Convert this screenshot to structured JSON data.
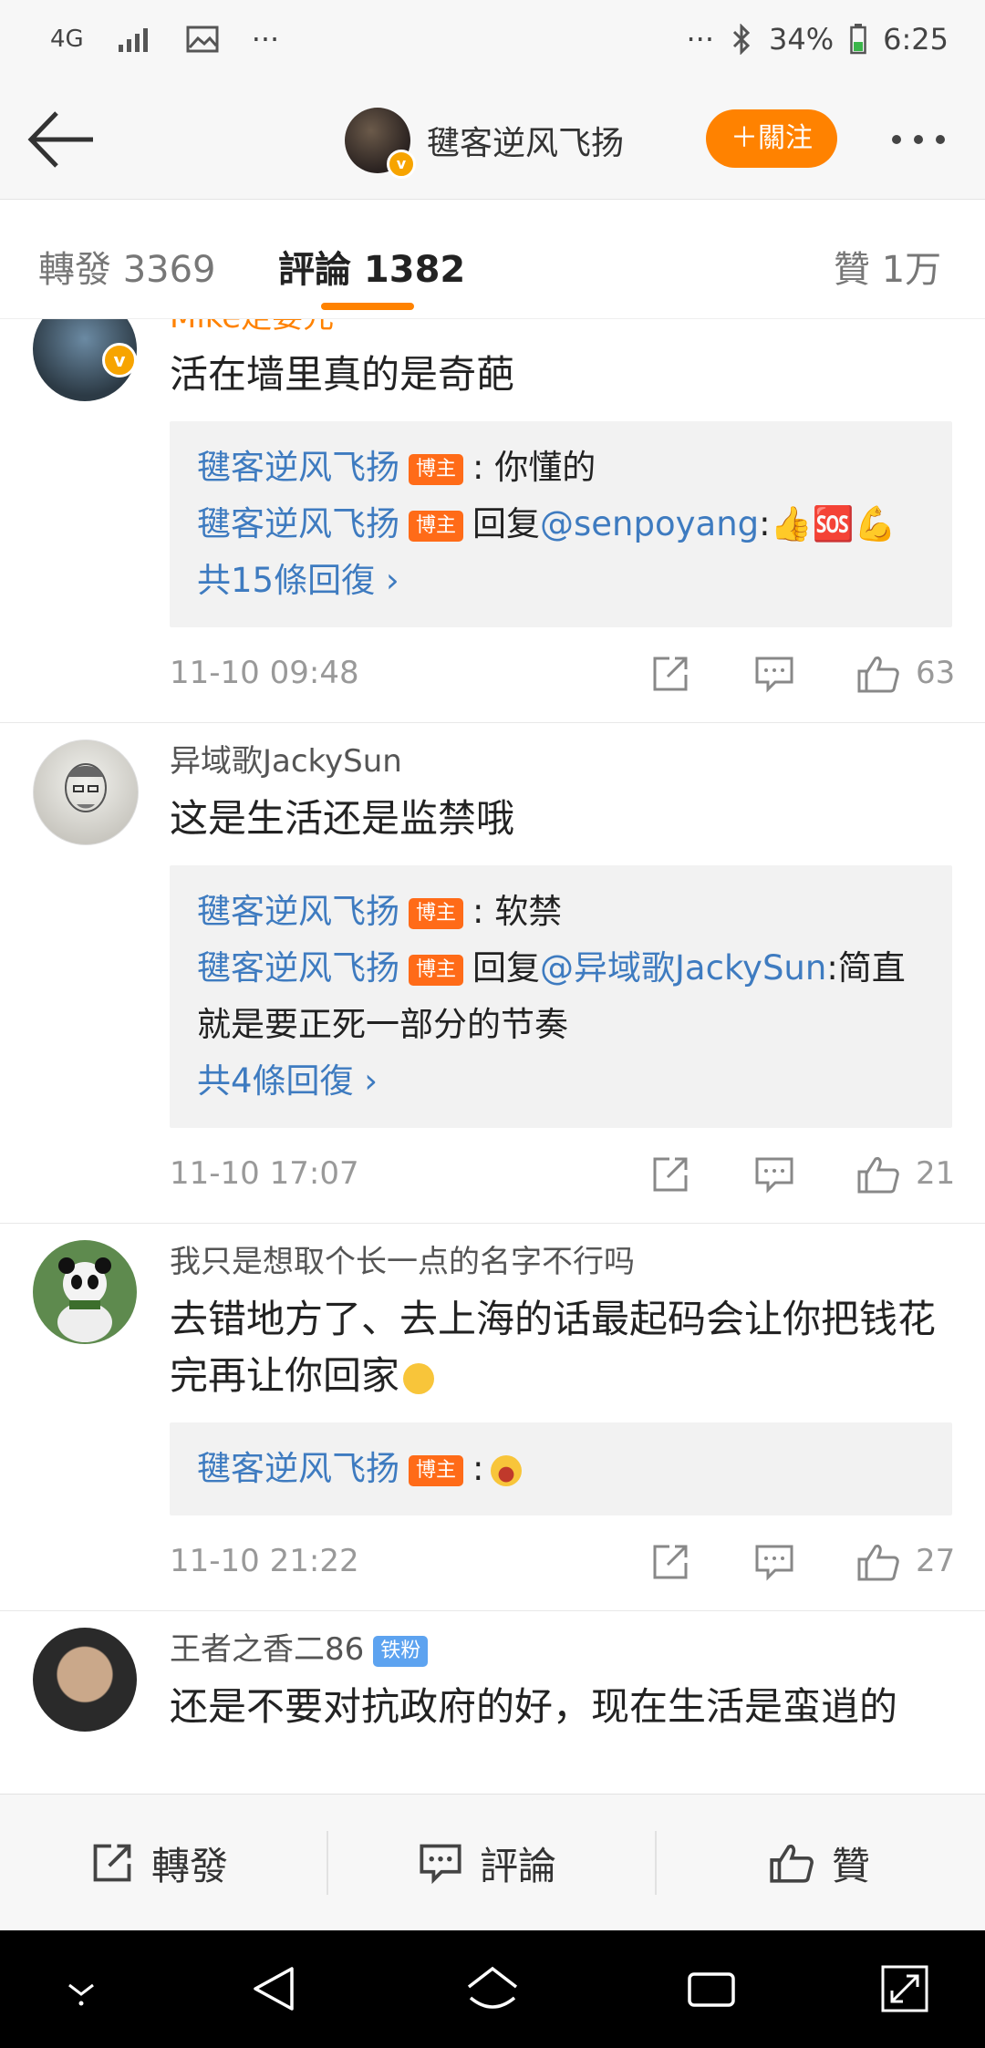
{
  "status_bar": {
    "network": "4G",
    "battery": "34%",
    "time": "6:25",
    "dots": "···"
  },
  "header": {
    "user_name": "毽客逆风飞扬",
    "follow_label": "＋關注"
  },
  "tabs": {
    "repost": "轉發 3369",
    "comments": "評論 1382",
    "likes": "贊 1万"
  },
  "comments": [
    {
      "name": "Mike走要元",
      "text": "活在墙里真的是奇葩",
      "replies": [
        {
          "name": "毽客逆风飞扬",
          "tag": "博主",
          "prefix": "",
          "mention": "",
          "text": ": 你懂的"
        },
        {
          "name": "毽客逆风飞扬",
          "tag": "博主",
          "prefix": "回复",
          "mention": "@senpoyang",
          "text": ":👍🆘💪"
        }
      ],
      "more": "共15條回復 ›",
      "time": "11-10 09:48",
      "likes": "63"
    },
    {
      "name": "异域歌JackySun",
      "text": "这是生活还是监禁哦",
      "replies": [
        {
          "name": "毽客逆风飞扬",
          "tag": "博主",
          "prefix": "",
          "mention": "",
          "text": ": 软禁"
        },
        {
          "name": "毽客逆风飞扬",
          "tag": "博主",
          "prefix": "回复",
          "mention": "@异域歌JackySun",
          "text": ":简直就是要正死一部分的节奏"
        }
      ],
      "more": "共4條回復 ›",
      "time": "11-10 17:07",
      "likes": "21"
    },
    {
      "name": "我只是想取个长一点的名字不行吗",
      "text": "去错地方了、去上海的话最起码会让你把钱花完再让你回家",
      "replies": [
        {
          "name": "毽客逆风飞扬",
          "tag": "博主",
          "prefix": "",
          "mention": "",
          "text": ":"
        }
      ],
      "more": "",
      "time": "11-10 21:22",
      "likes": "27"
    },
    {
      "name": "王者之香二86",
      "fan_tag": "铁粉",
      "text": "还是不要对抗政府的好，现在生活是蛮逍的"
    }
  ],
  "bottom_bar": {
    "repost": "轉發",
    "comment": "評論",
    "like": "贊"
  },
  "colors": {
    "accent": "#ff8200",
    "link": "#3e7bc0",
    "tag": "#ff6b18"
  }
}
